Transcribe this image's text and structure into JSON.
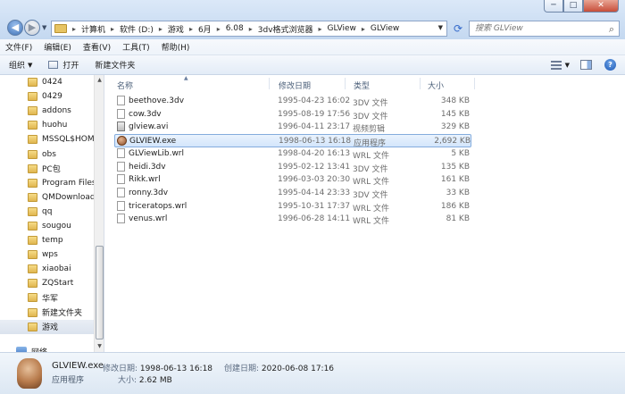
{
  "window": {
    "controls": {
      "minimize": "─",
      "maximize": "□",
      "close": "✕"
    }
  },
  "nav": {
    "back": "◀",
    "forward": "▶",
    "history": "▼"
  },
  "address": {
    "crumbs": [
      "计算机",
      "软件 (D:)",
      "游戏",
      "6月",
      "6.08",
      "3dv格式浏览器",
      "GLView",
      "GLView"
    ],
    "separator": "▸"
  },
  "search": {
    "placeholder": "搜索 GLView"
  },
  "menu": [
    "文件(F)",
    "编辑(E)",
    "查看(V)",
    "工具(T)",
    "帮助(H)"
  ],
  "toolbar": {
    "organize": "组织",
    "open": "打开",
    "new_folder": "新建文件夹"
  },
  "tree": [
    {
      "label": "0424"
    },
    {
      "label": "0429"
    },
    {
      "label": "addons"
    },
    {
      "label": "huohu"
    },
    {
      "label": "MSSQL$HOM"
    },
    {
      "label": "obs"
    },
    {
      "label": "PC包"
    },
    {
      "label": "Program Files"
    },
    {
      "label": "QMDownload"
    },
    {
      "label": "qq"
    },
    {
      "label": "sougou"
    },
    {
      "label": "temp"
    },
    {
      "label": "wps"
    },
    {
      "label": "xiaobai"
    },
    {
      "label": "ZQStart"
    },
    {
      "label": "华军"
    },
    {
      "label": "新建文件夹"
    },
    {
      "label": "游戏",
      "selected": true
    }
  ],
  "network": "网络",
  "columns": {
    "name": "名称",
    "date": "修改日期",
    "type": "类型",
    "size": "大小"
  },
  "files": [
    {
      "name": "beethove.3dv",
      "date": "1995-04-23 16:02",
      "type": "3DV 文件",
      "size": "348 KB",
      "icon": "file-icon"
    },
    {
      "name": "cow.3dv",
      "date": "1995-08-19 17:56",
      "type": "3DV 文件",
      "size": "145 KB",
      "icon": "file-icon"
    },
    {
      "name": "glview.avi",
      "date": "1996-04-11 23:17",
      "type": "视频剪辑",
      "size": "329 KB",
      "icon": "video-file-icon"
    },
    {
      "name": "GLVIEW.exe",
      "date": "1998-06-13 16:18",
      "type": "应用程序",
      "size": "2,692 KB",
      "icon": "exe-icon",
      "selected": true
    },
    {
      "name": "GLViewLib.wrl",
      "date": "1998-04-20 16:13",
      "type": "WRL 文件",
      "size": "5 KB",
      "icon": "file-icon"
    },
    {
      "name": "heidi.3dv",
      "date": "1995-02-12 13:41",
      "type": "3DV 文件",
      "size": "135 KB",
      "icon": "file-icon"
    },
    {
      "name": "Rikk.wrl",
      "date": "1996-03-03 20:30",
      "type": "WRL 文件",
      "size": "161 KB",
      "icon": "file-icon"
    },
    {
      "name": "ronny.3dv",
      "date": "1995-04-14 23:33",
      "type": "3DV 文件",
      "size": "33 KB",
      "icon": "file-icon"
    },
    {
      "name": "triceratops.wrl",
      "date": "1995-10-31 17:37",
      "type": "WRL 文件",
      "size": "186 KB",
      "icon": "file-icon"
    },
    {
      "name": "venus.wrl",
      "date": "1996-06-28 14:11",
      "type": "WRL 文件",
      "size": "81 KB",
      "icon": "file-icon"
    }
  ],
  "details": {
    "name": "GLVIEW.exe",
    "type": "应用程序",
    "modified_label": "修改日期:",
    "modified_value": "1998-06-13 16:18",
    "created_label": "创建日期:",
    "created_value": "2020-06-08 17:16",
    "size_label": "大小:",
    "size_value": "2.62 MB"
  }
}
